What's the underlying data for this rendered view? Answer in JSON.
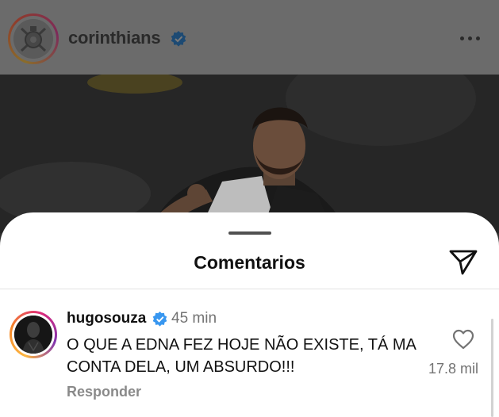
{
  "post": {
    "username": "corinthians",
    "verified": true,
    "more_icon": "more-horizontal-icon"
  },
  "comments_sheet": {
    "title": "Comentarios",
    "share_icon": "send-icon"
  },
  "comment": {
    "username": "hugosouza",
    "verified": true,
    "time": "45 min",
    "text": "O QUE A EDNA FEZ HOJE NÃO EXISTE, TÁ MA CONTA DELA, UM ABSURDO!!!",
    "reply_label": "Responder",
    "like_count": "17.8 mil",
    "like_icon": "heart-icon"
  },
  "colors": {
    "verified_blue": "#3897f0",
    "overlay_dark": "#2f2f2f",
    "sheet_bg": "#ffffff"
  }
}
